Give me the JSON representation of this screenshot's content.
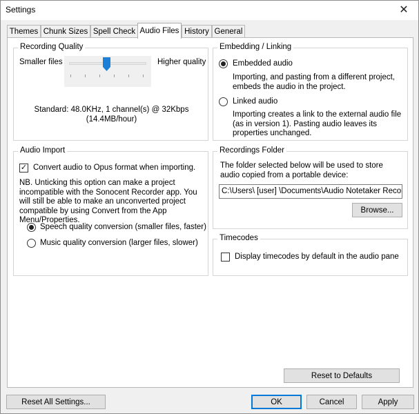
{
  "window": {
    "title": "Settings",
    "close_glyph": "✕"
  },
  "tabs": [
    {
      "label": "Themes"
    },
    {
      "label": "Chunk Sizes"
    },
    {
      "label": "Spell Check"
    },
    {
      "label": "Audio Files",
      "active": true
    },
    {
      "label": "History"
    },
    {
      "label": "General"
    }
  ],
  "recording_quality": {
    "title": "Recording Quality",
    "min_label": "Smaller files",
    "max_label": "Higher quality",
    "slider_level": 0.5,
    "standard_line1": "Standard: 48.0KHz, 1 channel(s) @ 32Kbps",
    "standard_line2": "(14.4MB/hour)"
  },
  "embedding": {
    "title": "Embedding / Linking",
    "embedded_label": "Embedded audio",
    "embedded_selected": true,
    "embedded_desc": "Importing, and pasting from a different project, embeds the audio in the project.",
    "linked_label": "Linked audio",
    "linked_desc": "Importing creates a link to the external audio file (as in version 1). Pasting audio leaves its properties unchanged."
  },
  "audio_import": {
    "title": "Audio Import",
    "convert_label": "Convert audio to Opus format when importing.",
    "convert_checked": true,
    "note": "NB. Unticking this option can make a project incompatible with the Sonocent Recorder app. You will still be able to make an unconverted project compatible by using Convert from the App Menu/Properties.",
    "speech_label": "Speech quality conversion (smaller files, faster)",
    "music_label": "Music quality conversion (larger files, slower)",
    "speech_selected": true
  },
  "recordings_folder": {
    "title": "Recordings Folder",
    "desc": "The folder selected below will be used to store audio copied from a portable device:",
    "path": "C:\\Users\\ [user] \\Documents\\Audio Notetaker Recor",
    "browse_label": "Browse..."
  },
  "timecodes": {
    "title": "Timecodes",
    "display_label": "Display timecodes by default in the audio pane",
    "display_checked": false
  },
  "buttons": {
    "reset_defaults": "Reset to Defaults",
    "reset_all": "Reset All Settings...",
    "ok": "OK",
    "cancel": "Cancel",
    "apply": "Apply"
  },
  "colors": {
    "slider_thumb": "#1e7fd6",
    "default_button_border": "#0078d7"
  }
}
